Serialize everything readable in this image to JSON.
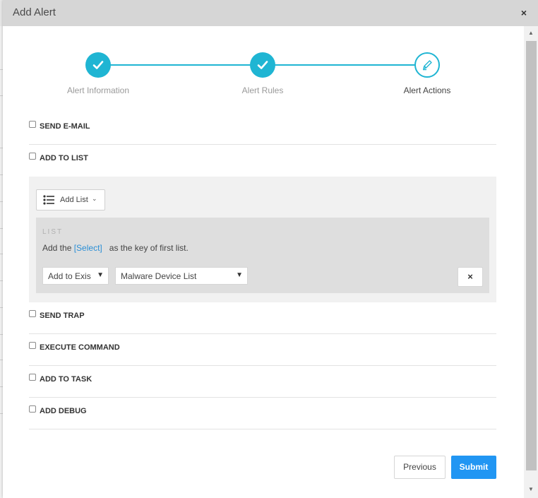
{
  "dialog": {
    "title": "Add Alert",
    "close_label": "×"
  },
  "stepper": {
    "steps": [
      {
        "label": "Alert Information",
        "state": "done"
      },
      {
        "label": "Alert Rules",
        "state": "done"
      },
      {
        "label": "Alert Actions",
        "state": "active"
      }
    ],
    "accent_color": "#1fb5d3"
  },
  "actions": {
    "send_email": {
      "label": "SEND E-MAIL",
      "checked": false
    },
    "add_to_list": {
      "label": "ADD TO LIST",
      "checked": false
    },
    "send_trap": {
      "label": "SEND TRAP",
      "checked": false
    },
    "execute_command": {
      "label": "EXECUTE COMMAND",
      "checked": false
    },
    "add_to_task": {
      "label": "ADD TO TASK",
      "checked": false
    },
    "add_debug": {
      "label": "ADD DEBUG",
      "checked": false
    }
  },
  "list_panel": {
    "add_list_button": "Add List",
    "add_list_icon": "list-icon",
    "heading": "LIST",
    "desc_prefix": "Add the",
    "select_link": "[Select]",
    "desc_suffix": "as the key of first list.",
    "mode_select_value": "Add to Exis",
    "list_select_value": "Malware Device List",
    "remove_label": "×"
  },
  "footer": {
    "previous_label": "Previous",
    "submit_label": "Submit",
    "submit_color": "#2196f3"
  }
}
